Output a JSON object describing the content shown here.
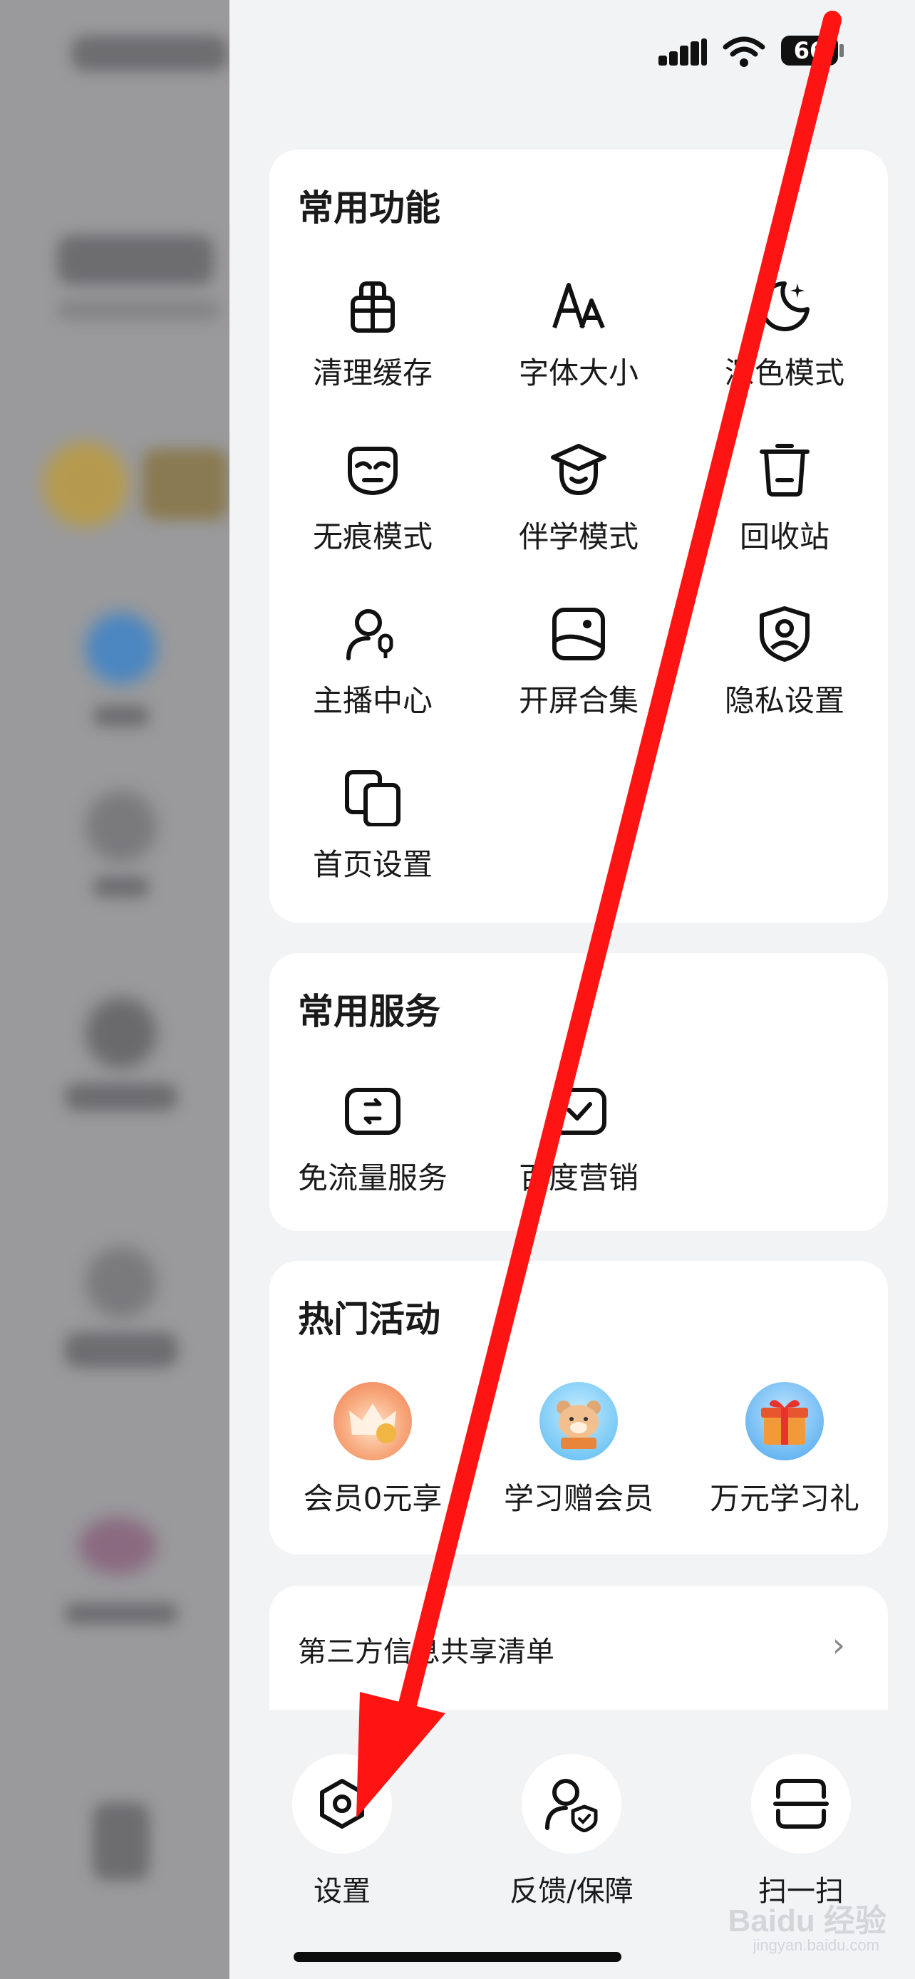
{
  "status_bar": {
    "battery": "66"
  },
  "common_functions": {
    "title": "常用功能",
    "items": [
      {
        "label": "清理缓存",
        "icon": "broom-icon"
      },
      {
        "label": "字体大小",
        "icon": "font-size-icon"
      },
      {
        "label": "深色模式",
        "icon": "moon-icon"
      },
      {
        "label": "无痕模式",
        "icon": "mask-icon"
      },
      {
        "label": "伴学模式",
        "icon": "graduation-cap-icon"
      },
      {
        "label": "回收站",
        "icon": "trash-icon"
      },
      {
        "label": "主播中心",
        "icon": "streamer-icon"
      },
      {
        "label": "开屏合集",
        "icon": "image-icon"
      },
      {
        "label": "隐私设置",
        "icon": "shield-user-icon"
      },
      {
        "label": "首页设置",
        "icon": "home-settings-icon"
      }
    ]
  },
  "common_services": {
    "title": "常用服务",
    "items": [
      {
        "label": "免流量服务",
        "icon": "data-free-icon"
      },
      {
        "label": "百度营销",
        "icon": "marketing-icon"
      }
    ]
  },
  "hot_activities": {
    "title": "热门活动",
    "items": [
      {
        "label": "会员0元享",
        "icon": "crown-gift-icon"
      },
      {
        "label": "学习赠会员",
        "icon": "bear-icon"
      },
      {
        "label": "万元学习礼",
        "icon": "gift-box-icon"
      }
    ]
  },
  "third_party": {
    "label": "第三方信息共享清单",
    "arrow": "›"
  },
  "bottom_bar": {
    "items": [
      {
        "label": "设置",
        "icon": "settings-icon"
      },
      {
        "label": "反馈/保障",
        "icon": "feedback-icon"
      },
      {
        "label": "扫一扫",
        "icon": "scan-icon"
      }
    ]
  },
  "watermark": {
    "text": "Baidu 经验",
    "sub": "jingyan.baidu.com"
  },
  "colors": {
    "arrow": "#ff1414",
    "card": "#ffffff",
    "background": "#f2f3f5"
  }
}
